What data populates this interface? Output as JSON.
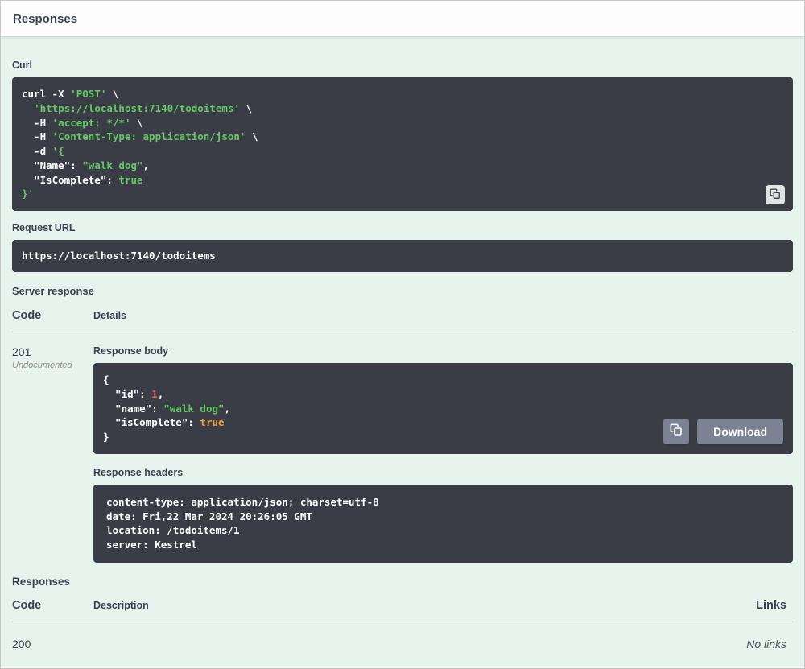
{
  "header": {
    "title": "Responses"
  },
  "curl": {
    "label": "Curl",
    "lines": [
      [
        {
          "t": "curl -X ",
          "c": "plain"
        },
        {
          "t": "'POST'",
          "c": "str"
        },
        {
          "t": " \\",
          "c": "plain"
        }
      ],
      [
        {
          "t": "  ",
          "c": "plain"
        },
        {
          "t": "'https://localhost:7140/todoitems'",
          "c": "str"
        },
        {
          "t": " \\",
          "c": "plain"
        }
      ],
      [
        {
          "t": "  -H ",
          "c": "plain"
        },
        {
          "t": "'accept: */*'",
          "c": "str"
        },
        {
          "t": " \\",
          "c": "plain"
        }
      ],
      [
        {
          "t": "  -H ",
          "c": "plain"
        },
        {
          "t": "'Content-Type: application/json'",
          "c": "str"
        },
        {
          "t": " \\",
          "c": "plain"
        }
      ],
      [
        {
          "t": "  -d ",
          "c": "plain"
        },
        {
          "t": "'{",
          "c": "str"
        }
      ],
      [
        {
          "t": "  \"Name\"",
          "c": "plain"
        },
        {
          "t": ": ",
          "c": "plain"
        },
        {
          "t": "\"walk dog\"",
          "c": "str"
        },
        {
          "t": ",",
          "c": "plain"
        }
      ],
      [
        {
          "t": "  \"IsComplete\"",
          "c": "plain"
        },
        {
          "t": ": ",
          "c": "plain"
        },
        {
          "t": "true",
          "c": "str"
        }
      ],
      [
        {
          "t": "}'",
          "c": "str"
        }
      ]
    ]
  },
  "request_url": {
    "label": "Request URL",
    "value": "https://localhost:7140/todoitems"
  },
  "server_response": {
    "label": "Server response",
    "code_header": "Code",
    "details_header": "Details",
    "status_code": "201",
    "undocumented_note": "Undocumented",
    "response_body_label": "Response body",
    "response_headers_label": "Response headers",
    "download_label": "Download"
  },
  "response_body": {
    "lines": [
      [
        {
          "t": "{",
          "c": "plain"
        }
      ],
      [
        {
          "t": "  \"id\": ",
          "c": "plain"
        },
        {
          "t": "1",
          "c": "num"
        },
        {
          "t": ",",
          "c": "plain"
        }
      ],
      [
        {
          "t": "  \"name\": ",
          "c": "plain"
        },
        {
          "t": "\"walk dog\"",
          "c": "str"
        },
        {
          "t": ",",
          "c": "plain"
        }
      ],
      [
        {
          "t": "  \"isComplete\": ",
          "c": "plain"
        },
        {
          "t": "true",
          "c": "bool"
        }
      ],
      [
        {
          "t": "}",
          "c": "plain"
        }
      ]
    ]
  },
  "response_headers": {
    "lines": [
      [
        {
          "t": "content-type: application/json; charset=utf-8",
          "c": "plain"
        }
      ],
      [
        {
          "t": "date: Fri,22 Mar 2024 20:26:05 GMT",
          "c": "plain"
        }
      ],
      [
        {
          "t": "location: /todoitems/1",
          "c": "plain"
        }
      ],
      [
        {
          "t": "server: Kestrel",
          "c": "plain"
        }
      ]
    ]
  },
  "responses_table": {
    "label": "Responses",
    "code_header": "Code",
    "description_header": "Description",
    "links_header": "Links",
    "rows": [
      {
        "code": "200",
        "description": "",
        "links": "No links"
      }
    ]
  },
  "icons": {
    "copy_curl": "clipboard-copy-icon",
    "copy_response": "clipboard-copy-icon"
  },
  "colors": {
    "panel_bg": "#e7f3ed",
    "section_header_bg": "#fdfdfd",
    "code_block_bg": "#3a3d45",
    "text_dark": "#3b4151",
    "code_plain": "#ffffff",
    "code_string": "#64c864",
    "code_number": "#e25d5d",
    "code_boolean": "#efa13f",
    "button_gray": "#7d8293",
    "undocumented_gray": "#8e8e8e"
  }
}
